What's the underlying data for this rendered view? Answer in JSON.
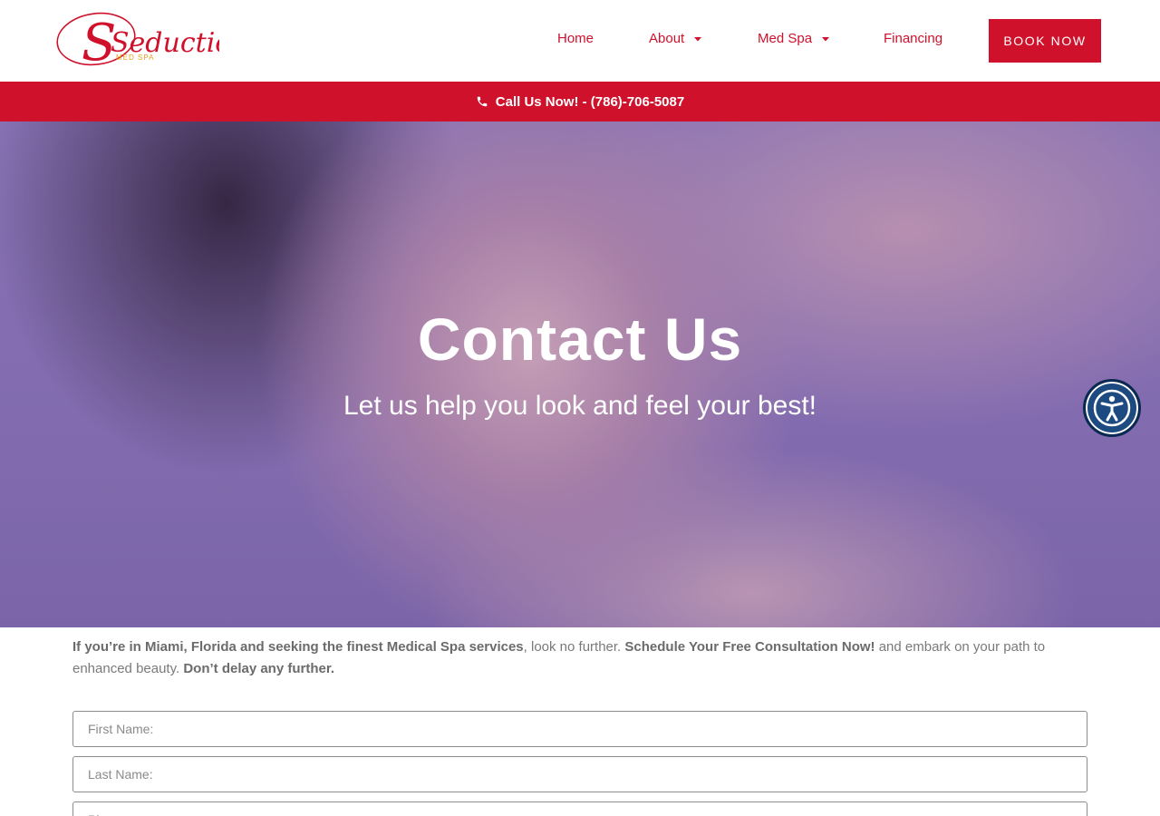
{
  "brand": {
    "logo_text": "Seduction",
    "logo_sub": "MED SPA",
    "accent": "#d0112b"
  },
  "nav": {
    "items": [
      {
        "label": "Home",
        "has_dropdown": false
      },
      {
        "label": "About",
        "has_dropdown": true
      },
      {
        "label": "Med Spa",
        "has_dropdown": true
      },
      {
        "label": "Financing",
        "has_dropdown": false
      }
    ],
    "cta": "BOOK NOW"
  },
  "callbar": {
    "text": "Call Us Now! - (786)-706-5087",
    "icon": "phone-icon"
  },
  "hero": {
    "title": "Contact Us",
    "subtitle": "Let us help you look and feel your best!"
  },
  "accessibility": {
    "icon": "accessibility-icon"
  },
  "intro": {
    "part1": "If you’re in Miami, Florida and seeking the finest Medical Spa services",
    "part2": ", look no further. ",
    "part3": "Schedule Your Free Consultation Now!",
    "part4": " and embark on your path to enhanced beauty. ",
    "part5": "Don’t delay any further."
  },
  "form": {
    "first_name_placeholder": "First Name:",
    "last_name_placeholder": "Last Name:",
    "third_placeholder": "Phone:"
  }
}
